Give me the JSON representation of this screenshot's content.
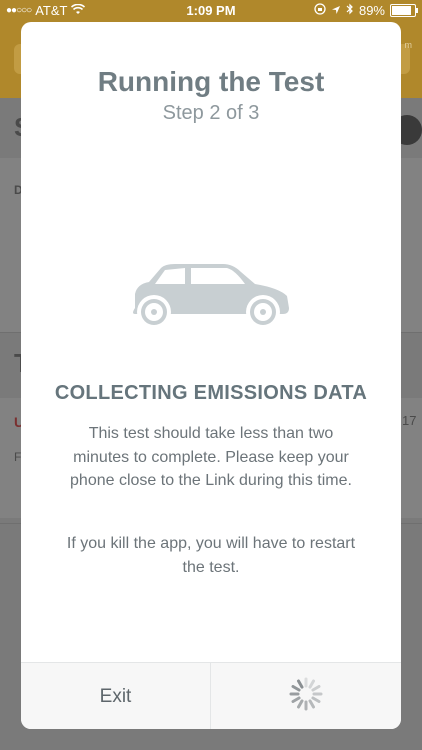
{
  "status_bar": {
    "signal_dots": "●●○○○",
    "carrier": "AT&T",
    "time": "1:09 PM",
    "battery_text": "89%",
    "icons": [
      "wifi-icon",
      "lock-rotation-icon",
      "location-icon",
      "bluetooth-icon",
      "battery-icon"
    ]
  },
  "modal": {
    "title": "Running the Test",
    "step": "Step 2 of 3",
    "image": "car-icon",
    "heading": "COLLECTING EMISSIONS DATA",
    "body": "This test should take less than two minutes to complete. Please keep your phone close to the Link during this time.",
    "note": "If you kill the app, you will have to restart the test.",
    "exit_label": "Exit",
    "spinner": "spinner-icon"
  },
  "colors": {
    "title": "#707d83",
    "heading": "#66757c",
    "body_text": "#6c7479",
    "car": "#c8cfd2",
    "background_header": "#b0882b",
    "overlay": "#6d6d6d"
  }
}
